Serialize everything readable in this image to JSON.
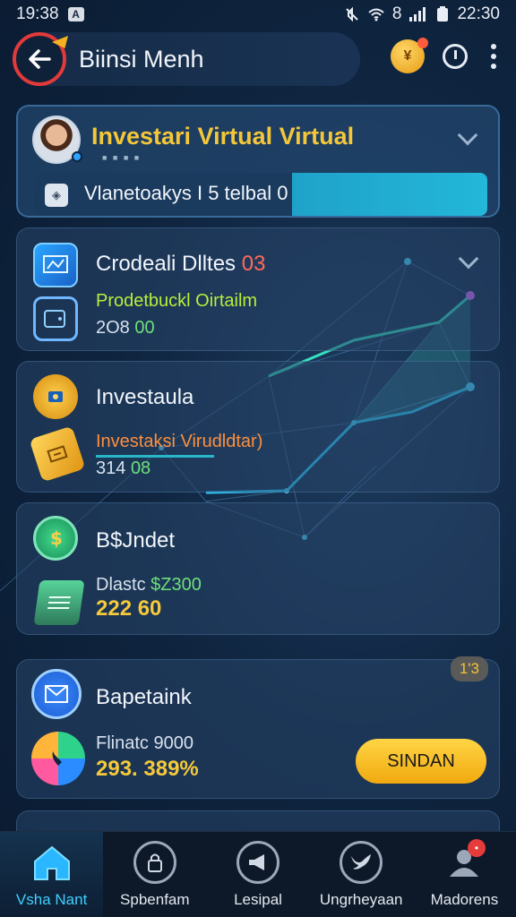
{
  "status_bar": {
    "time": "19:38",
    "app_badge": "A",
    "right_time": "22:30",
    "indicator": "8"
  },
  "header": {
    "title": "Biinsi Menh"
  },
  "cards": {
    "profile": {
      "title": "Investari Virtual Virtual",
      "dots": "■ ■ ■ ■",
      "progress_text": "Vlanetoakys I 5 telbal 0",
      "progress_percent": 57
    },
    "card2": {
      "title": "Crodeali Dlltes",
      "title_suffix": "03",
      "subtitle": "Prodetbuckl Oirtailm",
      "number_a": "2O8",
      "number_b": "00"
    },
    "card3": {
      "title": "Investaula",
      "subtitle": "Investaksi Virudldtar)",
      "number_a": "314",
      "number_b": "08"
    },
    "card4": {
      "title": "B$Jndet",
      "line_prefix": "Dlastc",
      "line_value": "$Z300",
      "big_value": "222 60"
    },
    "card5": {
      "title": "Bapetaink",
      "badge": "1'3",
      "line": "Flinatc 9000",
      "big_value": "293. 389%",
      "button_label": "SINDAN"
    }
  },
  "bottom_nav": [
    {
      "label": "Vsha Nant",
      "icon": "home-icon",
      "active": true
    },
    {
      "label": "Spbenfam",
      "icon": "lock-icon",
      "active": false
    },
    {
      "label": "Lesipal",
      "icon": "megaphone-icon",
      "active": false
    },
    {
      "label": "Ungrheyaan",
      "icon": "bird-icon",
      "active": false
    },
    {
      "label": "Madorens",
      "icon": "user-icon",
      "active": false,
      "badge": "•"
    }
  ],
  "colors": {
    "accent_gold": "#f4c73a",
    "accent_cyan": "#23b7d9",
    "accent_green": "#6ee07a",
    "accent_red": "#e23a3a"
  }
}
